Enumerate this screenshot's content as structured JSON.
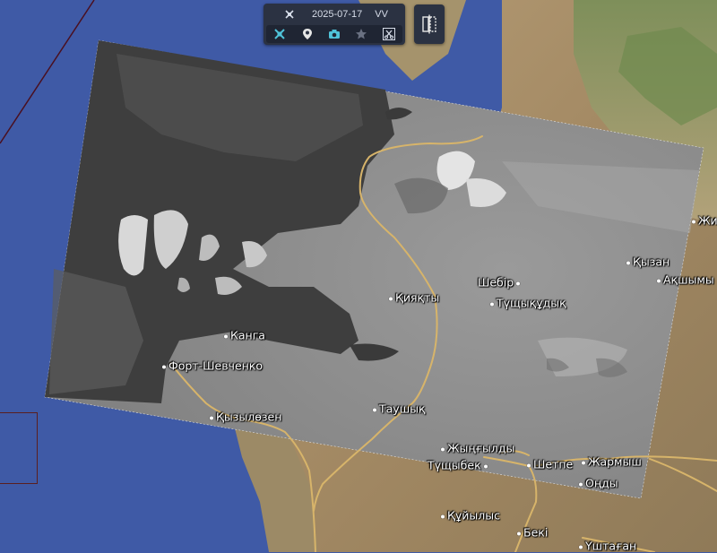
{
  "toolbar": {
    "date": "2025-07-17",
    "layer": "VV",
    "icons": [
      "satellite-icon",
      "pin-icon",
      "camera-icon",
      "star-icon",
      "scissors-icon"
    ]
  },
  "compare_icon": "compare-split-icon",
  "colors": {
    "sea": "#3f5aa6",
    "toolbar_bg": "#2b3242",
    "accent": "#4fc3d9",
    "road": "#d7b46a"
  },
  "places": [
    {
      "id": "kiyakty",
      "name": "Қияқты"
    },
    {
      "id": "shebir",
      "name": "Шебір"
    },
    {
      "id": "tushchykudyk",
      "name": "Түщықұдық"
    },
    {
      "id": "kyzan",
      "name": "Қызан"
    },
    {
      "id": "akshymy",
      "name": "Ақшымы"
    },
    {
      "id": "zhi",
      "name": "Жи"
    },
    {
      "id": "kanga",
      "name": "Канга"
    },
    {
      "id": "fort-shevchenko",
      "name": "Форт-Шевченко"
    },
    {
      "id": "kyzylozen",
      "name": "Қызылөзен"
    },
    {
      "id": "taushyk",
      "name": "Таушық"
    },
    {
      "id": "zhyngyldy",
      "name": "Жыңғылды"
    },
    {
      "id": "tushchybek",
      "name": "Түщыбек"
    },
    {
      "id": "shetpe",
      "name": "Шетпе"
    },
    {
      "id": "zharmysh",
      "name": "Жармыш"
    },
    {
      "id": "ondy",
      "name": "Оңды"
    },
    {
      "id": "kuiylys",
      "name": "Құйылыс"
    },
    {
      "id": "beki",
      "name": "Бекі"
    },
    {
      "id": "ushtagan",
      "name": "Үштаған"
    }
  ]
}
